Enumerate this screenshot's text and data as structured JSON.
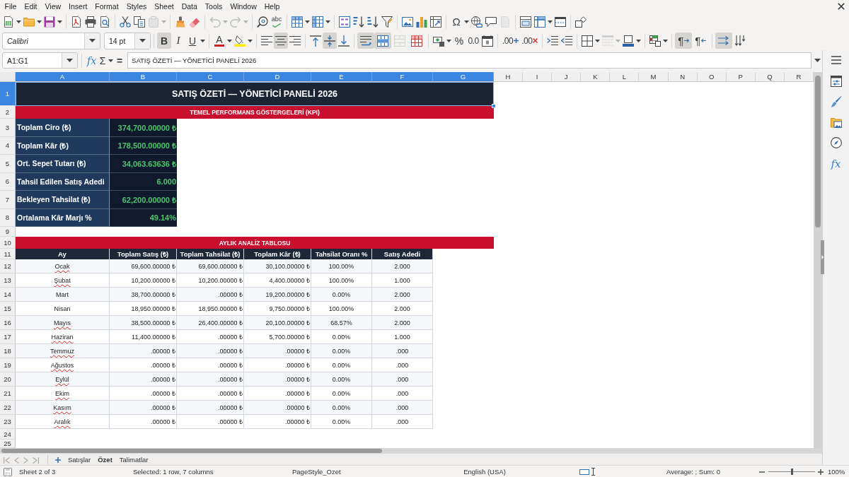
{
  "menu_bar": {
    "items": [
      "File",
      "Edit",
      "View",
      "Insert",
      "Format",
      "Styles",
      "Sheet",
      "Data",
      "Tools",
      "Window",
      "Help"
    ]
  },
  "standard_toolbar": {
    "paste_disabled": true,
    "undo_disabled": true,
    "redo_disabled": true,
    "spelling_glyph": "abc",
    "special_character_glyph": "Ω",
    "header_footer_disabled": true
  },
  "formatting_toolbar": {
    "font_name": "Calibri",
    "font_size": "14 pt",
    "bold": {
      "glyph": "B",
      "on": true
    },
    "italic": {
      "glyph": "I",
      "on": false
    },
    "underline": {
      "glyph": "U",
      "on": false
    },
    "font_color_glyph": "A",
    "align_left_on": false,
    "align_center_on": true,
    "align_right_on": false,
    "align_top_on": false,
    "align_middle_on": true,
    "align_bottom_on": false,
    "wrap_text_on": true,
    "merge_and_center_on": true,
    "merge_cells_disabled": true,
    "percent_glyph": "%",
    "standard_format_glyph": "0.0",
    "add_decimal_glyph": ".00",
    "delete_decimal_glyph": ".00",
    "border_style_disabled": true,
    "left_to_right": {
      "glyph": "¶",
      "on": true
    },
    "right_to_left": {
      "glyph": "¶",
      "on": false
    },
    "horizontal_text_on": true,
    "vertical_text_on": false
  },
  "formula_bar": {
    "name_box": "A1:G1",
    "function_wizard_glyph": "fx",
    "sum_glyph": "Σ",
    "formula_glyph": "=",
    "content": "SATIŞ ÖZETİ — YÖNETİCİ PANELİ 2026"
  },
  "sheet": {
    "column_headers": [
      {
        "label": "A",
        "selected": true
      },
      {
        "label": "B",
        "selected": true
      },
      {
        "label": "C",
        "selected": true
      },
      {
        "label": "D",
        "selected": true
      },
      {
        "label": "E",
        "selected": true
      },
      {
        "label": "F",
        "selected": true
      },
      {
        "label": "G",
        "selected": true
      },
      {
        "label": "H",
        "selected": false
      },
      {
        "label": "I",
        "selected": false
      },
      {
        "label": "J",
        "selected": false
      },
      {
        "label": "K",
        "selected": false
      },
      {
        "label": "L",
        "selected": false
      },
      {
        "label": "M",
        "selected": false
      },
      {
        "label": "N",
        "selected": false
      },
      {
        "label": "O",
        "selected": false
      },
      {
        "label": "P",
        "selected": false
      },
      {
        "label": "Q",
        "selected": false
      },
      {
        "label": "R",
        "selected": false
      }
    ],
    "row_headers": [
      {
        "label": "1",
        "selected": true
      },
      {
        "label": "2",
        "selected": false
      },
      {
        "label": "3",
        "selected": false
      },
      {
        "label": "4",
        "selected": false
      },
      {
        "label": "5",
        "selected": false
      },
      {
        "label": "6",
        "selected": false
      },
      {
        "label": "7",
        "selected": false
      },
      {
        "label": "8",
        "selected": false
      },
      {
        "label": "9",
        "selected": false
      },
      {
        "label": "10",
        "selected": false
      },
      {
        "label": "11",
        "selected": false
      },
      {
        "label": "12",
        "selected": false
      },
      {
        "label": "13",
        "selected": false
      },
      {
        "label": "14",
        "selected": false
      },
      {
        "label": "15",
        "selected": false
      },
      {
        "label": "16",
        "selected": false
      },
      {
        "label": "17",
        "selected": false
      },
      {
        "label": "18",
        "selected": false
      },
      {
        "label": "19",
        "selected": false
      },
      {
        "label": "20",
        "selected": false
      },
      {
        "label": "21",
        "selected": false
      },
      {
        "label": "22",
        "selected": false
      },
      {
        "label": "23",
        "selected": false
      },
      {
        "label": "24",
        "selected": false
      },
      {
        "label": "25",
        "selected": false
      }
    ],
    "title_cell": {
      "text": "SATIŞ ÖZETİ — YÖNETİCİ PANELİ 2026",
      "selected": true
    },
    "kpi_banner": "TEMEL PERFORMANS GÖSTERGELERİ (KPI)",
    "kpis": [
      {
        "label": "Toplam Ciro (₺)",
        "value": "374,700.00000 ₺"
      },
      {
        "label": "Toplam Kâr (₺)",
        "value": "178,500.00000 ₺"
      },
      {
        "label": "Ort. Sepet Tutarı (₺)",
        "value": "34,063.63636 ₺"
      },
      {
        "label": "Tahsil Edilen Satış Adedi",
        "value": "6.000"
      },
      {
        "label": "Bekleyen Tahsilat (₺)",
        "value": "62,200.00000 ₺"
      },
      {
        "label": "Ortalama Kâr Marjı %",
        "value": "49.14%"
      }
    ],
    "table_banner": "AYLIK ANALİZ TABLOSU",
    "table": {
      "columns": [
        "Ay",
        "Toplam Satış (₺)",
        "Toplam Tahsilat (₺)",
        "Toplam Kâr (₺)",
        "Tahsilat Oranı %",
        "Satış Adedi"
      ],
      "rows": [
        {
          "spell_error": true,
          "cells": [
            "Ocak",
            "69,600.00000 ₺",
            "69,600.00000 ₺",
            "30,100.00000 ₺",
            "100.00%",
            "2.000"
          ]
        },
        {
          "spell_error": true,
          "cells": [
            "Şubat",
            "10,200.00000 ₺",
            "10,200.00000 ₺",
            "4,400.00000 ₺",
            "100.00%",
            "1.000"
          ]
        },
        {
          "spell_error": false,
          "cells": [
            "Mart",
            "38,700.00000 ₺",
            ".00000 ₺",
            "19,200.00000 ₺",
            "0.00%",
            "2.000"
          ]
        },
        {
          "spell_error": false,
          "cells": [
            "Nisan",
            "18,950.00000 ₺",
            "18,950.00000 ₺",
            "9,750.00000 ₺",
            "100.00%",
            "2.000"
          ]
        },
        {
          "spell_error": true,
          "cells": [
            "Mayıs",
            "38,500.00000 ₺",
            "26,400.00000 ₺",
            "20,100.00000 ₺",
            "68.57%",
            "2.000"
          ]
        },
        {
          "spell_error": true,
          "cells": [
            "Haziran",
            "11,400.00000 ₺",
            ".00000 ₺",
            "5,700.00000 ₺",
            "0.00%",
            "1.000"
          ]
        },
        {
          "spell_error": true,
          "cells": [
            "Temmuz",
            ".00000 ₺",
            ".00000 ₺",
            ".00000 ₺",
            "0.00%",
            ".000"
          ]
        },
        {
          "spell_error": true,
          "cells": [
            "Ağustos",
            ".00000 ₺",
            ".00000 ₺",
            ".00000 ₺",
            "0.00%",
            ".000"
          ]
        },
        {
          "spell_error": true,
          "cells": [
            "Eylül",
            ".00000 ₺",
            ".00000 ₺",
            ".00000 ₺",
            "0.00%",
            ".000"
          ]
        },
        {
          "spell_error": true,
          "cells": [
            "Ekim",
            ".00000 ₺",
            ".00000 ₺",
            ".00000 ₺",
            "0.00%",
            ".000"
          ]
        },
        {
          "spell_error": true,
          "cells": [
            "Kasım",
            ".00000 ₺",
            ".00000 ₺",
            ".00000 ₺",
            "0.00%",
            ".000"
          ]
        },
        {
          "spell_error": true,
          "cells": [
            "Aralık",
            ".00000 ₺",
            ".00000 ₺",
            ".00000 ₺",
            "0.00%",
            ".000"
          ]
        }
      ]
    }
  },
  "sheet_tabs": {
    "navigation_disabled": true,
    "tabs": [
      {
        "label": "Satışlar",
        "selected": false
      },
      {
        "label": "Özet",
        "selected": true
      },
      {
        "label": "Talimatlar",
        "selected": false
      }
    ]
  },
  "sidebar": {
    "functions_glyph": "fx"
  },
  "status_bar": {
    "sheet_position": "Sheet 2 of 3",
    "selection": "Selected: 1 row, 7 columns",
    "page_style": "PageStyle_Ozet",
    "language": "English (USA)",
    "statistics": "Average: ; Sum: 0",
    "zoom": {
      "level": 0.5,
      "reading": "100%"
    }
  }
}
